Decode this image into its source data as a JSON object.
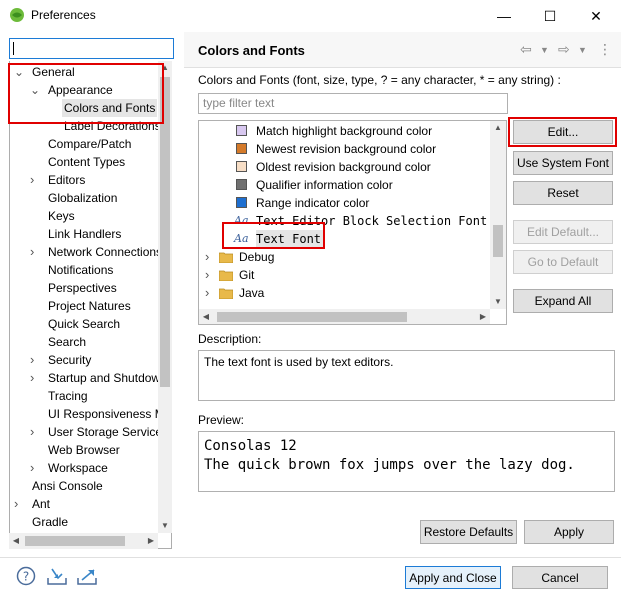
{
  "window": {
    "title": "Preferences",
    "min_glyph": "—",
    "max_glyph": "☐",
    "close_glyph": "✕"
  },
  "left": {
    "filter_value": "",
    "tree": [
      {
        "label": "General",
        "twisty": "open"
      },
      {
        "label": "Appearance",
        "twisty": "open"
      },
      {
        "label": "Colors and Fonts",
        "twisty": "none",
        "selected": true
      },
      {
        "label": "Label Decorations",
        "twisty": "none"
      },
      {
        "label": "Compare/Patch",
        "twisty": "none"
      },
      {
        "label": "Content Types",
        "twisty": "none"
      },
      {
        "label": "Editors",
        "twisty": "closed"
      },
      {
        "label": "Globalization",
        "twisty": "none"
      },
      {
        "label": "Keys",
        "twisty": "none"
      },
      {
        "label": "Link Handlers",
        "twisty": "none"
      },
      {
        "label": "Network Connections",
        "twisty": "closed"
      },
      {
        "label": "Notifications",
        "twisty": "none"
      },
      {
        "label": "Perspectives",
        "twisty": "none"
      },
      {
        "label": "Project Natures",
        "twisty": "none"
      },
      {
        "label": "Quick Search",
        "twisty": "none"
      },
      {
        "label": "Search",
        "twisty": "none"
      },
      {
        "label": "Security",
        "twisty": "closed"
      },
      {
        "label": "Startup and Shutdown",
        "twisty": "closed"
      },
      {
        "label": "Tracing",
        "twisty": "none"
      },
      {
        "label": "UI Responsiveness Monitoring",
        "twisty": "none"
      },
      {
        "label": "User Storage Service",
        "twisty": "closed"
      },
      {
        "label": "Web Browser",
        "twisty": "none"
      },
      {
        "label": "Workspace",
        "twisty": "closed"
      },
      {
        "label": "Ansi Console",
        "twisty": "none"
      },
      {
        "label": "Ant",
        "twisty": "closed"
      },
      {
        "label": "Gradle",
        "twisty": "none"
      }
    ]
  },
  "right": {
    "title": "Colors and Fonts",
    "nav_back": "⇦",
    "nav_fwd": "⇨",
    "nav_menu": "⋮",
    "description_line": "Colors and Fonts (font, size, type, ? = any character, * = any string) :",
    "filter_placeholder": "type filter text",
    "items": [
      {
        "label": "Match highlight background color",
        "kind": "color",
        "color": "#d8c8f0"
      },
      {
        "label": "Newest revision background color",
        "kind": "color",
        "color": "#d47a2a"
      },
      {
        "label": "Oldest revision background color",
        "kind": "color",
        "color": "#f7dec6"
      },
      {
        "label": "Qualifier information color",
        "kind": "color",
        "color": "#707070"
      },
      {
        "label": "Range indicator color",
        "kind": "color",
        "color": "#1e6fd0"
      },
      {
        "label": "Text Editor Block Selection Font",
        "kind": "font"
      },
      {
        "label": "Text Font",
        "kind": "font",
        "selected": true
      },
      {
        "label": "Debug",
        "kind": "category"
      },
      {
        "label": "Git",
        "kind": "category"
      },
      {
        "label": "Java",
        "kind": "category"
      }
    ],
    "font_icon_label": "Aa",
    "buttons": {
      "edit": "Edit...",
      "use_system_font": "Use System Font",
      "reset": "Reset",
      "edit_default": "Edit Default...",
      "go_to_default": "Go to Default",
      "expand_all": "Expand All"
    },
    "description_label": "Description:",
    "description_text": "The text font is used by text editors.",
    "preview_label": "Preview:",
    "preview_lines": [
      "Consolas 12",
      "The quick brown fox jumps over the lazy dog."
    ],
    "restore_defaults": "Restore Defaults",
    "apply": "Apply"
  },
  "footer": {
    "apply_close": "Apply and Close",
    "cancel": "Cancel"
  },
  "colors": {
    "highlight_red": "#e00000",
    "selection_bg": "#e5e5e5",
    "focus_blue": "#1c7bd6"
  }
}
